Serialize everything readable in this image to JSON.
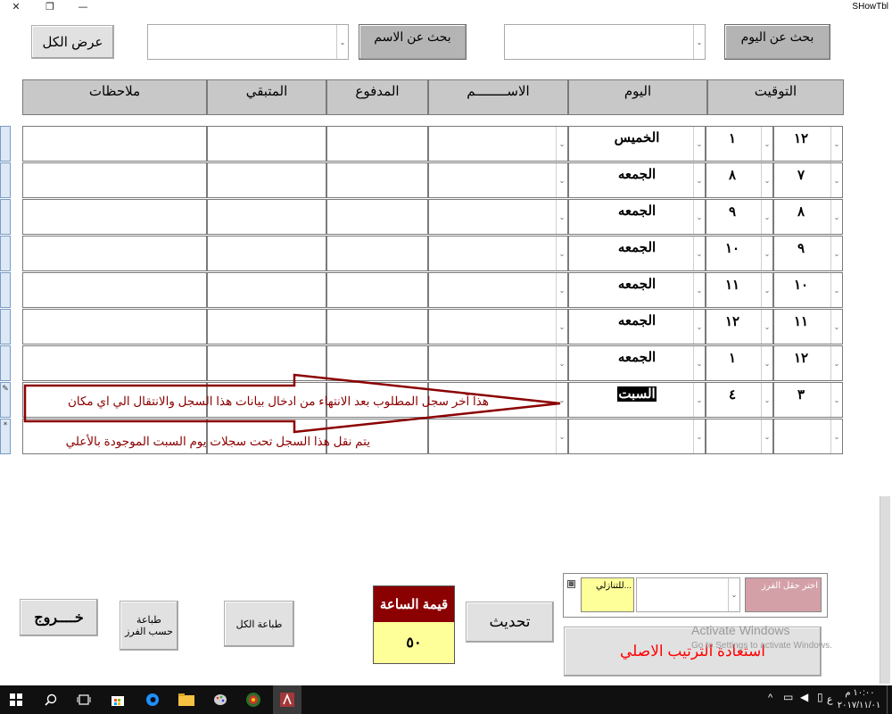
{
  "window": {
    "title": "SHowTbl",
    "close_glyph": "✕",
    "restore_glyph": "❐",
    "minimize_glyph": "—"
  },
  "toolbar": {
    "show_all": "عرض الكل",
    "search_name": "بحث عن الاسم",
    "search_day": "بحث عن اليوم"
  },
  "columns": {
    "time": "التوقيت",
    "day": "اليوم",
    "name": "الاســــــــم",
    "paid": "المدفوع",
    "remaining": "المتبقي",
    "notes": "ملاحظات"
  },
  "rows": [
    {
      "hour": "١٢",
      "minute": "١",
      "day": "الخميس"
    },
    {
      "hour": "٧",
      "minute": "٨",
      "day": "الجمعه"
    },
    {
      "hour": "٨",
      "minute": "٩",
      "day": "الجمعه"
    },
    {
      "hour": "٩",
      "minute": "١٠",
      "day": "الجمعه"
    },
    {
      "hour": "١٠",
      "minute": "١١",
      "day": "الجمعه"
    },
    {
      "hour": "١١",
      "minute": "١٢",
      "day": "الجمعه"
    },
    {
      "hour": "١٢",
      "minute": "١",
      "day": "الجمعه"
    },
    {
      "hour": "٣",
      "minute": "٤",
      "day": "السبت"
    },
    {
      "hour": "",
      "minute": "",
      "day": ""
    }
  ],
  "row_selectors": {
    "current": "✎",
    "new": "*"
  },
  "annotations": {
    "arrow_text": "هذا آخر سجل المطلوب بعد الانتهاء من ادخال بيانات هذا السجل والانتقال الي اي مكان",
    "move_text": "يتم نقل هذا السجل تحت سجلات يوم السبت الموجودة بالأعلي"
  },
  "bottom": {
    "exit": "خــــروج",
    "print_by_sort_line1": "طباعة",
    "print_by_sort_line2": "حسب الفرز",
    "print_all": "طباعة الكل",
    "hour_rate_label": "قيمة الساعة",
    "hour_rate_value": "٥٠",
    "refresh": "تحديث",
    "sort_field_button": "اختر حقل الفرز",
    "sort_order_value": "للتنازلي...",
    "restore_order": "استعادة الترتيب الاصلي"
  },
  "watermark": {
    "line1": "Activate Windows",
    "line2": "Go to Settings to activate Windows."
  },
  "taskbar": {
    "icons": [
      "windows-start-icon",
      "search-icon",
      "task-view-icon",
      "store-icon",
      "edge-icon",
      "file-explorer-icon",
      "paint-icon",
      "app-icon",
      "access-icon"
    ],
    "lang": "ع",
    "time": "١٠:٠٠ م",
    "date": "٢٠١٧/١١/٠١"
  },
  "colors": {
    "rate_header": "#8b0000",
    "rate_value_bg": "#ffff99",
    "annotation_text": "#8b0000",
    "restore_text": "#ff0000",
    "sort_button_bg": "#d4a0a8",
    "sort_order_bg": "#ffff99"
  }
}
